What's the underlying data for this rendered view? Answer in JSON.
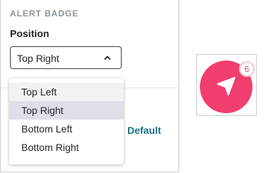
{
  "settings": {
    "section_title": "ALERT BADGE",
    "position_label": "Position",
    "position_value": "Top Right",
    "reset_label": "Default"
  },
  "dropdown": {
    "options": [
      {
        "label": "Top Left",
        "state": "hover"
      },
      {
        "label": "Top Right",
        "state": "selected"
      },
      {
        "label": "Bottom Left",
        "state": "normal"
      },
      {
        "label": "Bottom Right",
        "state": "normal"
      }
    ]
  },
  "preview": {
    "badge_count": "6",
    "launcher_color": "#f03e6e",
    "icon": "send-arrow-icon"
  },
  "colors": {
    "accent": "#1a7083",
    "brand": "#f03e6e"
  }
}
